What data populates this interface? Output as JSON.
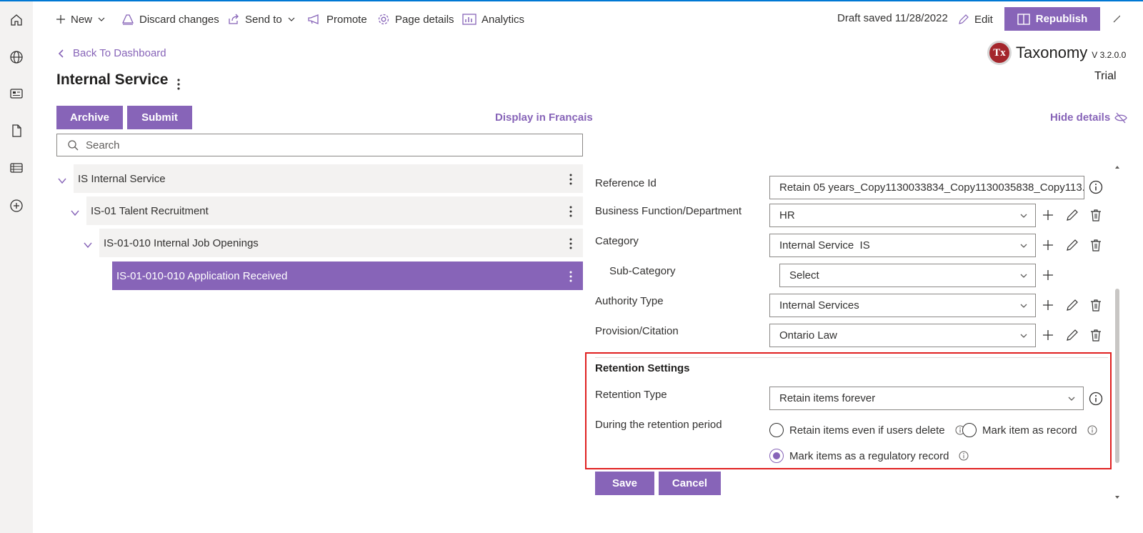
{
  "command_bar": {
    "new_label": "New",
    "discard_label": "Discard changes",
    "send_to_label": "Send to",
    "promote_label": "Promote",
    "page_details_label": "Page details",
    "analytics_label": "Analytics",
    "draft_status": "Draft saved 11/28/2022",
    "edit_label": "Edit",
    "republish_label": "Republish"
  },
  "nav": {
    "back_label": "Back To Dashboard"
  },
  "page": {
    "title": "Internal Service"
  },
  "brand": {
    "name": "Taxonomy",
    "version": "V 3.2.0.0",
    "logo_text": "Tx",
    "plan": "Trial"
  },
  "actions": {
    "archive_label": "Archive",
    "submit_label": "Submit",
    "display_fr_label": "Display in Français",
    "hide_details_label": "Hide details"
  },
  "search": {
    "placeholder": "Search"
  },
  "tree": {
    "items": [
      {
        "label": "IS Internal Service",
        "level": 0,
        "selected": false
      },
      {
        "label": "IS-01 Talent Recruitment",
        "level": 1,
        "selected": false
      },
      {
        "label": "IS-01-010 Internal Job Openings",
        "level": 2,
        "selected": false
      },
      {
        "label": "IS-01-010-010 Application Received",
        "level": 3,
        "selected": true
      }
    ]
  },
  "details": {
    "reference_id": {
      "label": "Reference Id",
      "value": "Retain 05 years_Copy1130033834_Copy1130035838_Copy113..."
    },
    "business_function": {
      "label": "Business Function/Department",
      "value": "HR"
    },
    "category": {
      "label": "Category",
      "value": "Internal Service  IS"
    },
    "sub_category": {
      "label": "Sub-Category",
      "value": "Select"
    },
    "authority_type": {
      "label": "Authority Type",
      "value": "Internal Services"
    },
    "provision": {
      "label": "Provision/Citation",
      "value": "Ontario Law"
    }
  },
  "retention": {
    "heading": "Retention Settings",
    "type_label": "Retention Type",
    "type_value": "Retain items forever",
    "period_label": "During the retention period",
    "options": {
      "retain_even_if_deleted": "Retain items even if users delete",
      "mark_as_record": "Mark item as record",
      "mark_regulatory": "Mark items as a regulatory record"
    },
    "selected_option": "mark_regulatory"
  },
  "footer": {
    "save_label": "Save",
    "cancel_label": "Cancel"
  },
  "colors": {
    "accent": "#8764b8",
    "highlight_border": "#e02020",
    "rail": "#f3f2f1"
  }
}
